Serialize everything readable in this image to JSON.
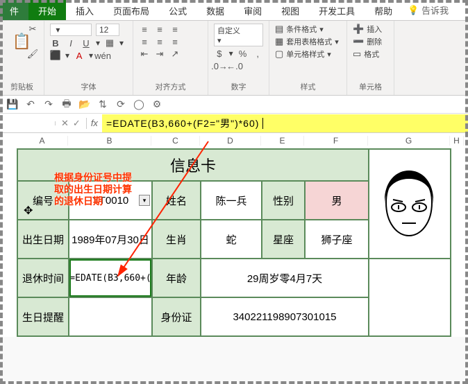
{
  "tabs": {
    "file": "件",
    "start": "开始",
    "insert": "插入",
    "layout": "页面布局",
    "formula": "公式",
    "data": "数据",
    "review": "审阅",
    "view": "视图",
    "dev": "开发工具",
    "help": "帮助",
    "tell": "告诉我"
  },
  "ribbon": {
    "clipboard": {
      "label": "剪贴板"
    },
    "font": {
      "label": "字体",
      "size": "12"
    },
    "align": {
      "label": "对齐方式"
    },
    "number": {
      "label": "数字"
    },
    "cond_fmt": "条件格式",
    "table_fmt": "套用表格格式",
    "cell_fmt": "单元格样式",
    "styles": "样式",
    "ins": "插入",
    "del": "删除",
    "fmt": "格式",
    "cells": "单元格"
  },
  "namebox": "",
  "formula": "=EDATE(B3,660+(F2=\"男\")*60)",
  "annotation": {
    "l1": "根据身份证号中提",
    "l2": "取的出生日期计算",
    "l3": "的退休日期"
  },
  "cols": {
    "A": "A",
    "B": "B",
    "C": "C",
    "D": "D",
    "E": "E",
    "F": "F",
    "G": "G",
    "H": "H"
  },
  "sheet": {
    "title": "信息卡",
    "r2": {
      "a": "编号",
      "b": "YT0010",
      "c": "姓名",
      "d": "陈一兵",
      "e": "性别",
      "f": "男"
    },
    "r3": {
      "a": "出生日期",
      "b": "1989年07月30日",
      "c": "生肖",
      "d": "蛇",
      "e": "星座",
      "f": "狮子座"
    },
    "r4": {
      "a": "退休时间",
      "b": "=EDATE(B3,660+(",
      "c": "年龄",
      "d": "29周岁零4月7天"
    },
    "r5": {
      "a": "生日提醒",
      "c": "身份证",
      "d": "340221198907301015"
    }
  }
}
